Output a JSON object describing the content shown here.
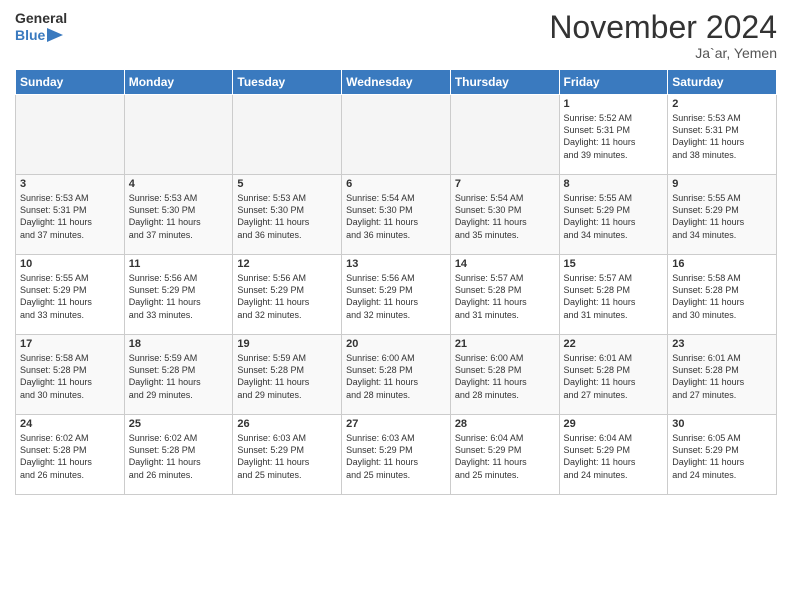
{
  "header": {
    "logo_line1": "General",
    "logo_line2": "Blue",
    "month_title": "November 2024",
    "location": "Ja`ar, Yemen"
  },
  "days_of_week": [
    "Sunday",
    "Monday",
    "Tuesday",
    "Wednesday",
    "Thursday",
    "Friday",
    "Saturday"
  ],
  "weeks": [
    [
      {
        "day": "",
        "info": ""
      },
      {
        "day": "",
        "info": ""
      },
      {
        "day": "",
        "info": ""
      },
      {
        "day": "",
        "info": ""
      },
      {
        "day": "",
        "info": ""
      },
      {
        "day": "1",
        "info": "Sunrise: 5:52 AM\nSunset: 5:31 PM\nDaylight: 11 hours\nand 39 minutes."
      },
      {
        "day": "2",
        "info": "Sunrise: 5:53 AM\nSunset: 5:31 PM\nDaylight: 11 hours\nand 38 minutes."
      }
    ],
    [
      {
        "day": "3",
        "info": "Sunrise: 5:53 AM\nSunset: 5:31 PM\nDaylight: 11 hours\nand 37 minutes."
      },
      {
        "day": "4",
        "info": "Sunrise: 5:53 AM\nSunset: 5:30 PM\nDaylight: 11 hours\nand 37 minutes."
      },
      {
        "day": "5",
        "info": "Sunrise: 5:53 AM\nSunset: 5:30 PM\nDaylight: 11 hours\nand 36 minutes."
      },
      {
        "day": "6",
        "info": "Sunrise: 5:54 AM\nSunset: 5:30 PM\nDaylight: 11 hours\nand 36 minutes."
      },
      {
        "day": "7",
        "info": "Sunrise: 5:54 AM\nSunset: 5:30 PM\nDaylight: 11 hours\nand 35 minutes."
      },
      {
        "day": "8",
        "info": "Sunrise: 5:55 AM\nSunset: 5:29 PM\nDaylight: 11 hours\nand 34 minutes."
      },
      {
        "day": "9",
        "info": "Sunrise: 5:55 AM\nSunset: 5:29 PM\nDaylight: 11 hours\nand 34 minutes."
      }
    ],
    [
      {
        "day": "10",
        "info": "Sunrise: 5:55 AM\nSunset: 5:29 PM\nDaylight: 11 hours\nand 33 minutes."
      },
      {
        "day": "11",
        "info": "Sunrise: 5:56 AM\nSunset: 5:29 PM\nDaylight: 11 hours\nand 33 minutes."
      },
      {
        "day": "12",
        "info": "Sunrise: 5:56 AM\nSunset: 5:29 PM\nDaylight: 11 hours\nand 32 minutes."
      },
      {
        "day": "13",
        "info": "Sunrise: 5:56 AM\nSunset: 5:29 PM\nDaylight: 11 hours\nand 32 minutes."
      },
      {
        "day": "14",
        "info": "Sunrise: 5:57 AM\nSunset: 5:28 PM\nDaylight: 11 hours\nand 31 minutes."
      },
      {
        "day": "15",
        "info": "Sunrise: 5:57 AM\nSunset: 5:28 PM\nDaylight: 11 hours\nand 31 minutes."
      },
      {
        "day": "16",
        "info": "Sunrise: 5:58 AM\nSunset: 5:28 PM\nDaylight: 11 hours\nand 30 minutes."
      }
    ],
    [
      {
        "day": "17",
        "info": "Sunrise: 5:58 AM\nSunset: 5:28 PM\nDaylight: 11 hours\nand 30 minutes."
      },
      {
        "day": "18",
        "info": "Sunrise: 5:59 AM\nSunset: 5:28 PM\nDaylight: 11 hours\nand 29 minutes."
      },
      {
        "day": "19",
        "info": "Sunrise: 5:59 AM\nSunset: 5:28 PM\nDaylight: 11 hours\nand 29 minutes."
      },
      {
        "day": "20",
        "info": "Sunrise: 6:00 AM\nSunset: 5:28 PM\nDaylight: 11 hours\nand 28 minutes."
      },
      {
        "day": "21",
        "info": "Sunrise: 6:00 AM\nSunset: 5:28 PM\nDaylight: 11 hours\nand 28 minutes."
      },
      {
        "day": "22",
        "info": "Sunrise: 6:01 AM\nSunset: 5:28 PM\nDaylight: 11 hours\nand 27 minutes."
      },
      {
        "day": "23",
        "info": "Sunrise: 6:01 AM\nSunset: 5:28 PM\nDaylight: 11 hours\nand 27 minutes."
      }
    ],
    [
      {
        "day": "24",
        "info": "Sunrise: 6:02 AM\nSunset: 5:28 PM\nDaylight: 11 hours\nand 26 minutes."
      },
      {
        "day": "25",
        "info": "Sunrise: 6:02 AM\nSunset: 5:28 PM\nDaylight: 11 hours\nand 26 minutes."
      },
      {
        "day": "26",
        "info": "Sunrise: 6:03 AM\nSunset: 5:29 PM\nDaylight: 11 hours\nand 25 minutes."
      },
      {
        "day": "27",
        "info": "Sunrise: 6:03 AM\nSunset: 5:29 PM\nDaylight: 11 hours\nand 25 minutes."
      },
      {
        "day": "28",
        "info": "Sunrise: 6:04 AM\nSunset: 5:29 PM\nDaylight: 11 hours\nand 25 minutes."
      },
      {
        "day": "29",
        "info": "Sunrise: 6:04 AM\nSunset: 5:29 PM\nDaylight: 11 hours\nand 24 minutes."
      },
      {
        "day": "30",
        "info": "Sunrise: 6:05 AM\nSunset: 5:29 PM\nDaylight: 11 hours\nand 24 minutes."
      }
    ]
  ]
}
